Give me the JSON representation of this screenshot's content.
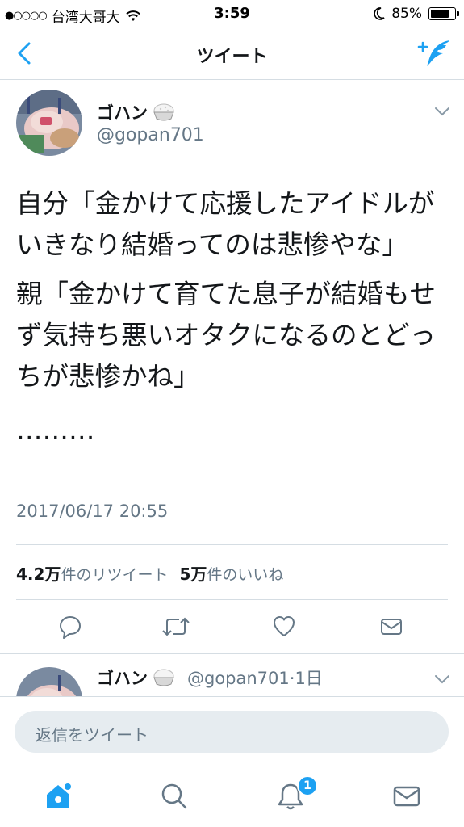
{
  "status_bar": {
    "signal": "●○○○○",
    "carrier": "台湾大哥大",
    "time": "3:59",
    "battery_percent": "85%",
    "battery_level": 0.85
  },
  "nav": {
    "title": "ツイート"
  },
  "tweet": {
    "display_name": "ゴハン",
    "handle": "@gopan701",
    "paragraphs": [
      "自分「金かけて応援したアイドルがいきなり結婚ってのは悲惨やな」",
      "親「金かけて育てた息子が結婚もせず気持ち悪いオタクになるのとどっちが悲惨かね」",
      "………"
    ],
    "timestamp": "2017/06/17 20:55",
    "retweet_count": "4.2万",
    "retweet_label": "件のリツイート",
    "like_count": "5万",
    "like_label": "件のいいね"
  },
  "reply_preview": {
    "display_name": "ゴハン",
    "meta": "@gopan701·1日"
  },
  "reply_box": {
    "placeholder": "返信をツイート"
  },
  "tab_bar": {
    "notification_badge": "1"
  },
  "colors": {
    "accent": "#1da1f2",
    "secondary_text": "#657786",
    "divider": "#d5dde3",
    "icon": "#657786"
  }
}
